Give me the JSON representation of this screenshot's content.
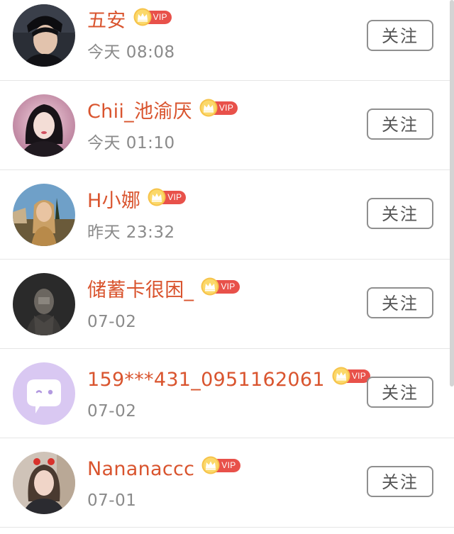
{
  "follow_label": "关注",
  "vip_label": "VIP",
  "colors": {
    "name": "#d9542e",
    "vip_pill": "#e8514a",
    "crown": "#f2b43a",
    "time": "#8a8a8a",
    "button_border": "#8f8f8f"
  },
  "users": [
    {
      "name": "五安",
      "time": "今天 08:08",
      "avatar": "male-portrait-dark"
    },
    {
      "name": "Chii_池渝厌",
      "time": "今天 01:10",
      "avatar": "female-portrait-pink"
    },
    {
      "name": "H小娜",
      "time": "昨天 23:32",
      "avatar": "female-portrait-outdoor"
    },
    {
      "name": "储蓄卡很困_",
      "time": "07-02",
      "avatar": "dark-blurred-portrait"
    },
    {
      "name": "159***431_0951162061",
      "time": "07-02",
      "avatar": "default-chat-bubble"
    },
    {
      "name": "Nananaccc",
      "time": "07-01",
      "avatar": "female-portrait-selfie"
    }
  ]
}
